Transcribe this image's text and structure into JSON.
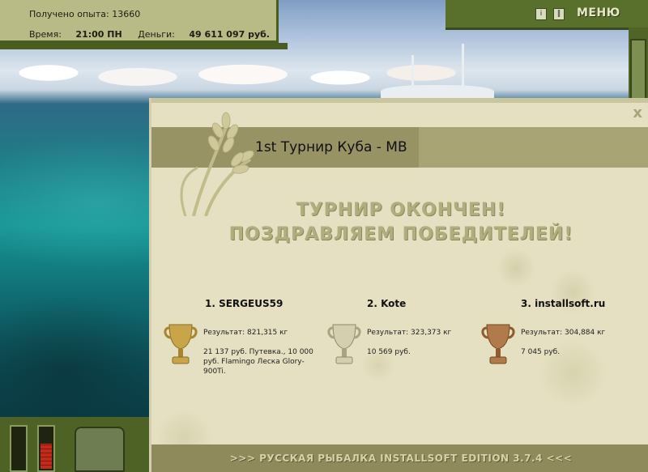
{
  "hud": {
    "exp_label": "Получено опыта:",
    "exp_value": "13660",
    "time_label": "Время:",
    "time_value": "21:00 ПН",
    "money_label": "Деньги:",
    "money_value": "49 611 097 руб."
  },
  "top_right": {
    "icons": [
      "info-icon",
      "pause-icon"
    ],
    "menu_label": "МЕНЮ"
  },
  "dialog": {
    "close_label": "x",
    "title": "1st Турнир Куба - МВ",
    "headline_1": "ТУРНИР ОКОНЧЕН!",
    "headline_2": "ПОЗДРАВЛЯЕМ ПОБЕДИТЕЛЕЙ!",
    "winners": [
      {
        "name": "1. SERGEUS59",
        "result": "Результат: 821,315 кг",
        "prize": "21 137 руб. Путевка., 10 000 руб. Flamingo Леска Glory-900Ti.",
        "trophy": "gold"
      },
      {
        "name": "2. Kote",
        "result": "Результат: 323,373 кг",
        "prize": "10 569 руб.",
        "trophy": "silver"
      },
      {
        "name": "3. installsoft.ru",
        "result": "Результат: 304,884 кг",
        "prize": "7 045 руб.",
        "trophy": "bronze"
      }
    ],
    "footer": ">>> РУССКАЯ РЫБАЛКА INSTALLSOFT EDITION 3.7.4 <<<"
  },
  "gauges": {
    "left_level": 0,
    "right_level": 0.62
  },
  "colors": {
    "gold": "#c9a54a",
    "silver": "#b8b39a",
    "bronze": "#b07a4a"
  }
}
